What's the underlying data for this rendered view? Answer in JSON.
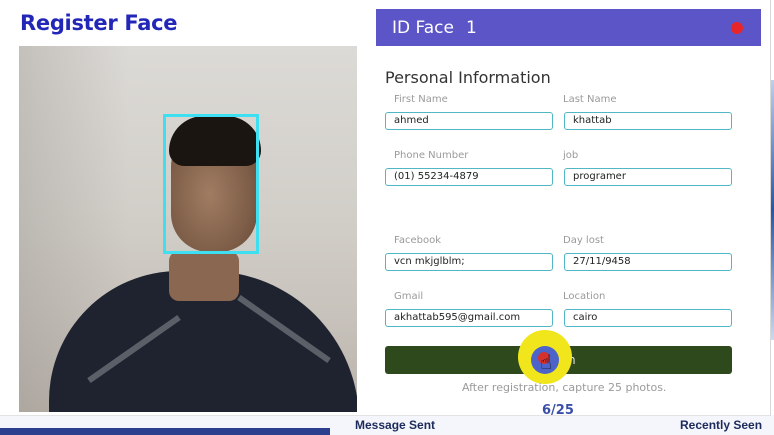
{
  "window": {
    "title": "Register Face"
  },
  "header": {
    "id_label": "ID Face",
    "id_value": "1",
    "record_color": "#e8262a"
  },
  "form": {
    "section_title": "Personal Information",
    "fields": [
      {
        "label": "First Name",
        "value": "ahmed"
      },
      {
        "label": "Last Name",
        "value": "khattab"
      },
      {
        "label": "Phone Number",
        "value": "(01) 55234-4879"
      },
      {
        "label": "job",
        "value": "programer"
      },
      {
        "label": "Facebook",
        "value": "vcn mkjglblm;"
      },
      {
        "label": "Day lost",
        "value": "27/11/9458"
      },
      {
        "label": "Gmail",
        "value": "akhattab595@gmail.com"
      },
      {
        "label": "Location",
        "value": "cairo"
      }
    ],
    "finish_label": "Finish",
    "hint": "After registration, capture 25 photos.",
    "counter": "6/25"
  },
  "background_window": {
    "left_text": "Message Sent",
    "right_text": "Recently Seen"
  },
  "colors": {
    "title": "#2327b8",
    "id_bar": "#5b55c8",
    "finish_button": "#2e4a1c",
    "input_border": "#52b7c4",
    "face_box": "#3ddff0"
  }
}
